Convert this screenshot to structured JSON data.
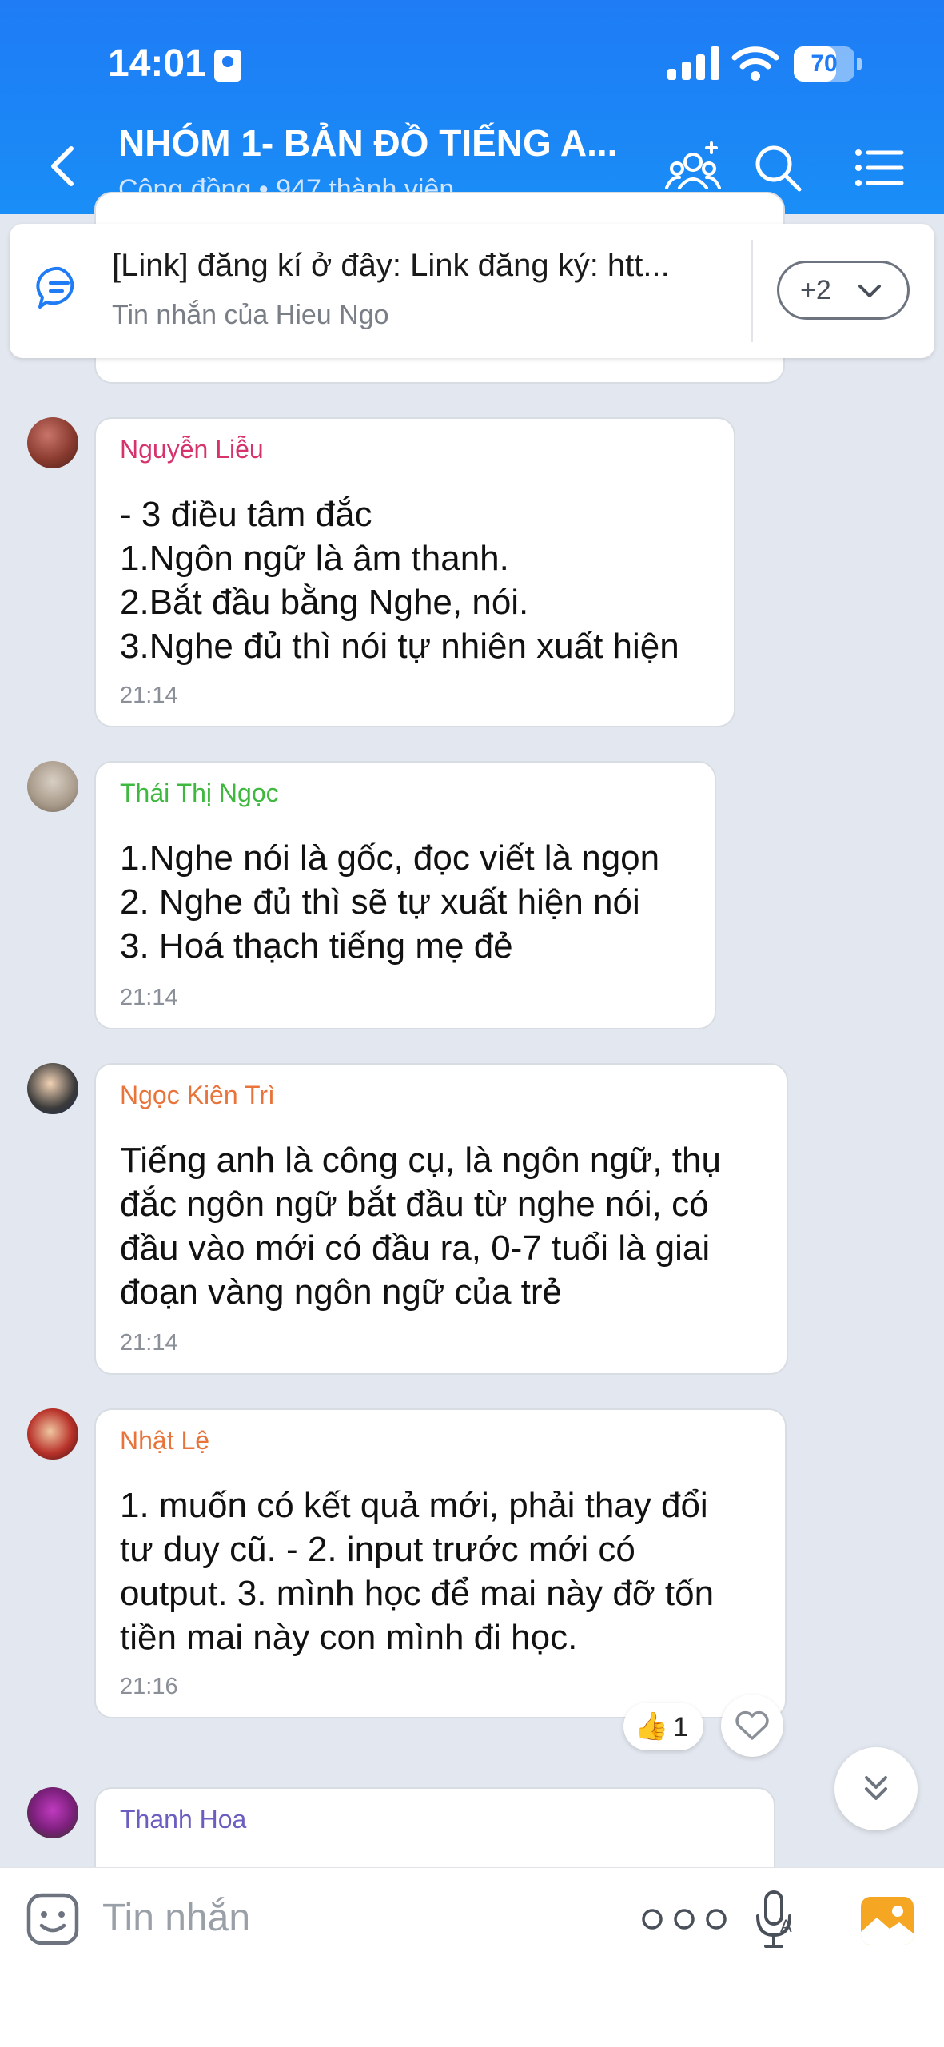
{
  "status_bar": {
    "time": "14:01",
    "battery": "70",
    "battery_level": 0.7
  },
  "header": {
    "title": "NHÓM 1- BẢN ĐỒ TIẾNG A...",
    "subtitle": "Cộng đồng • 947 thành viên"
  },
  "pinned": {
    "text": "[Link] đăng kí ở đây: Link đăng ký: htt...",
    "sub": "Tin nhắn của Hieu Ngo",
    "more": "+2"
  },
  "messages": [
    {
      "sender": "Nguyễn Liễu",
      "color": "#d6336c",
      "text": "- 3 điều tâm đắc\n1.Ngôn ngữ là âm thanh.\n2.Bắt đầu bằng Nghe, nói.\n3.Nghe đủ thì nói tự nhiên xuất hiện",
      "time": "21:14"
    },
    {
      "sender": "Thái Thị Ngọc",
      "color": "#3fb83f",
      "text": "1.Nghe nói là gốc, đọc viết là ngọn\n2. Nghe đủ thì sẽ tự xuất hiện nói\n3. Hoá thạch tiếng mẹ đẻ",
      "time": "21:14"
    },
    {
      "sender": "Ngọc Kiên Trì",
      "color": "#e8743b",
      "text": "Tiếng anh là công cụ, là ngôn ngữ, thụ\nđắc ngôn ngữ bắt đầu từ nghe nói, có\nđầu vào mới có đầu ra, 0-7 tuổi là giai\nđoạn vàng ngôn ngữ của trẻ",
      "time": "21:14"
    },
    {
      "sender": "Nhật Lệ",
      "color": "#e8743b",
      "text": "1.  muốn có kết quả mới, phải thay đổi\ntư duy cũ. - 2. input trước mới có\noutput. 3. mình học để mai này đỡ tốn\ntiền mai này con mình đi học.",
      "time": "21:16"
    },
    {
      "sender": "Thanh Hoa",
      "color": "#6a5fc1",
      "text": "",
      "time": ""
    }
  ],
  "reaction": {
    "emoji": "👍",
    "count": "1"
  },
  "input": {
    "placeholder": "Tin nhắn"
  },
  "colors": {
    "header": "#1f7cf5",
    "background": "#e3e7ef",
    "accent": "#1f7cf5"
  },
  "icons": [
    "lock-icon",
    "signal-icon",
    "wifi-icon",
    "battery-icon",
    "back-icon",
    "add-member-icon",
    "search-icon",
    "menu-icon",
    "pinned-message-icon",
    "chevron-down-icon",
    "heart-icon",
    "scroll-down-icon",
    "emoji-icon",
    "more-dots-icon",
    "voice-icon",
    "image-icon"
  ]
}
